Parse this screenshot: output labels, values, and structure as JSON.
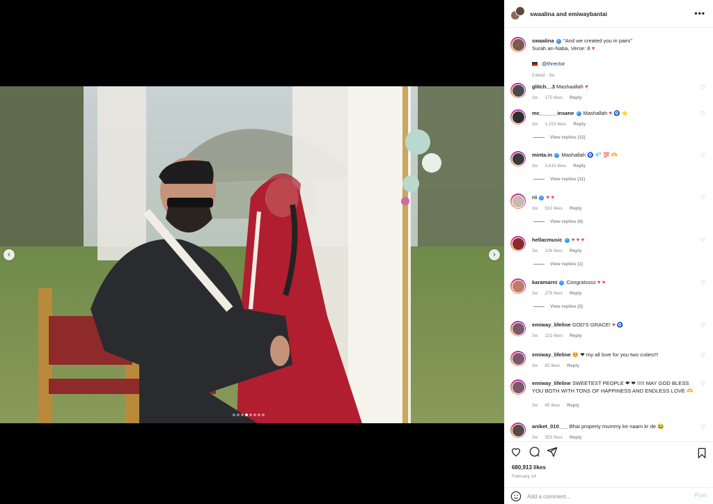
{
  "post": {
    "header_title": "swaalina and emiwaybantai",
    "more_label": "•••",
    "carousel_dots": 8,
    "carousel_active": 3
  },
  "caption": {
    "username": "swaalina",
    "line1": "\"And we created you in pairs\"",
    "line2": "Surah an-Naba, Verse: 8",
    "mention": "@thrector",
    "edited": "Edited · 3w"
  },
  "comments": [
    {
      "username": "glitch._.3",
      "verified": false,
      "text": "Mashaallah",
      "hearts": 1,
      "suffix": "",
      "time": "3w",
      "likes": "175 likes",
      "reply": "Reply",
      "view_replies": ""
    },
    {
      "username": "mc______insane",
      "verified": true,
      "text": "Mashallah",
      "hearts": 1,
      "suffix": "🧿 ⭐",
      "time": "3w",
      "likes": "1,152 likes",
      "reply": "Reply",
      "view_replies": "View replies (12)"
    },
    {
      "username": "minta.in",
      "verified": true,
      "text": "Mashallah",
      "hearts": 0,
      "suffix": "🧿 💎 💯 🫶",
      "time": "3w",
      "likes": "3,615 likes",
      "reply": "Reply",
      "view_replies": "View replies (11)"
    },
    {
      "username": "rii",
      "verified": true,
      "text": "",
      "hearts": 2,
      "suffix": "",
      "time": "3w",
      "likes": "532 likes",
      "reply": "Reply",
      "view_replies": "View replies (6)"
    },
    {
      "username": "hellacmusic",
      "verified": true,
      "text": "",
      "hearts": 3,
      "suffix": "",
      "time": "3w",
      "likes": "126 likes",
      "reply": "Reply",
      "view_replies": "View replies (1)"
    },
    {
      "username": "karamarni",
      "verified": true,
      "text": "Congratssss",
      "hearts": 2,
      "suffix": "",
      "time": "3w",
      "likes": "276 likes",
      "reply": "Reply",
      "view_replies": "View replies (2)"
    },
    {
      "username": "emiway_lifeline",
      "verified": false,
      "text": "GOD'S GRACE!",
      "hearts": 1,
      "suffix": "🧿",
      "time": "3w",
      "likes": "131 likes",
      "reply": "Reply",
      "view_replies": ""
    },
    {
      "username": "emiway_lifeline",
      "verified": false,
      "text": "🥺 ❤ my all love for you two cuties!!!",
      "hearts": 0,
      "suffix": "",
      "time": "3w",
      "likes": "82 likes",
      "reply": "Reply",
      "view_replies": ""
    },
    {
      "username": "emiway_lifeline",
      "verified": false,
      "text": "SWEETEST PEOPLE ❤ ❤ !!!!! MAY GOD BLESS YOU BOTH WITH TONS OF HAPPINESS AND ENDLESS LOVE 🫶",
      "hearts": 0,
      "suffix": "",
      "time": "3w",
      "likes": "45 likes",
      "reply": "Reply",
      "view_replies": ""
    },
    {
      "username": "aniket_010___",
      "verified": false,
      "text": "Bhai property mummy ke naam kr de",
      "hearts": 0,
      "suffix": "😂",
      "time": "3w",
      "likes": "553 likes",
      "reply": "Reply",
      "view_replies": ""
    }
  ],
  "footer": {
    "likes_count": "680,913 likes",
    "date": "February 14",
    "comment_placeholder": "Add a comment...",
    "post_label": "Post"
  },
  "colors": {
    "accent": "#0095f6",
    "heart": "#ed4956",
    "muted": "#8e8e8e"
  }
}
